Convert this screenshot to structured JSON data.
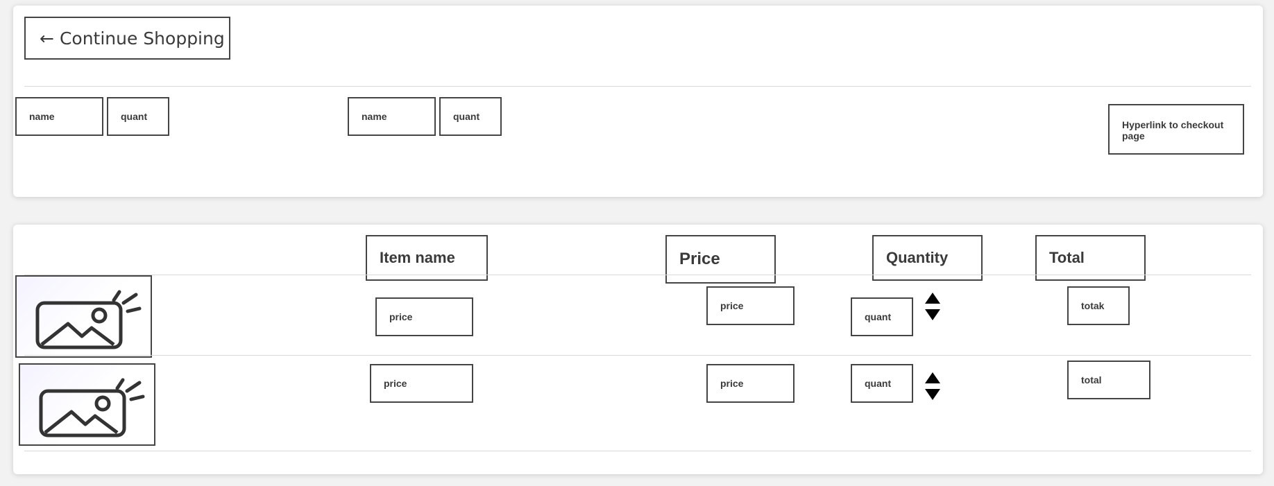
{
  "header": {
    "continue_arrow": "←",
    "continue_label": "Continue Shopping",
    "checkout_link": "Hyperlink to checkout page"
  },
  "summary_items": [
    {
      "name": "name",
      "quant": "quant"
    },
    {
      "name": "name",
      "quant": "quant"
    }
  ],
  "cart": {
    "columns": {
      "item_name": "Item name",
      "price": "Price",
      "quantity": "Quantity",
      "total": "Total"
    },
    "rows": [
      {
        "image": "image-placeholder-icon",
        "item": "price",
        "price": "price",
        "quant": "quant",
        "total": "totak"
      },
      {
        "image": "image-placeholder-icon",
        "item": "price",
        "price": "price",
        "quant": "quant",
        "total": "total"
      }
    ]
  },
  "colors": {
    "background": "#f2f2f2",
    "card": "#ffffff",
    "border": "#444444",
    "text": "#3a3a3a",
    "divider": "#d9d9d9"
  }
}
